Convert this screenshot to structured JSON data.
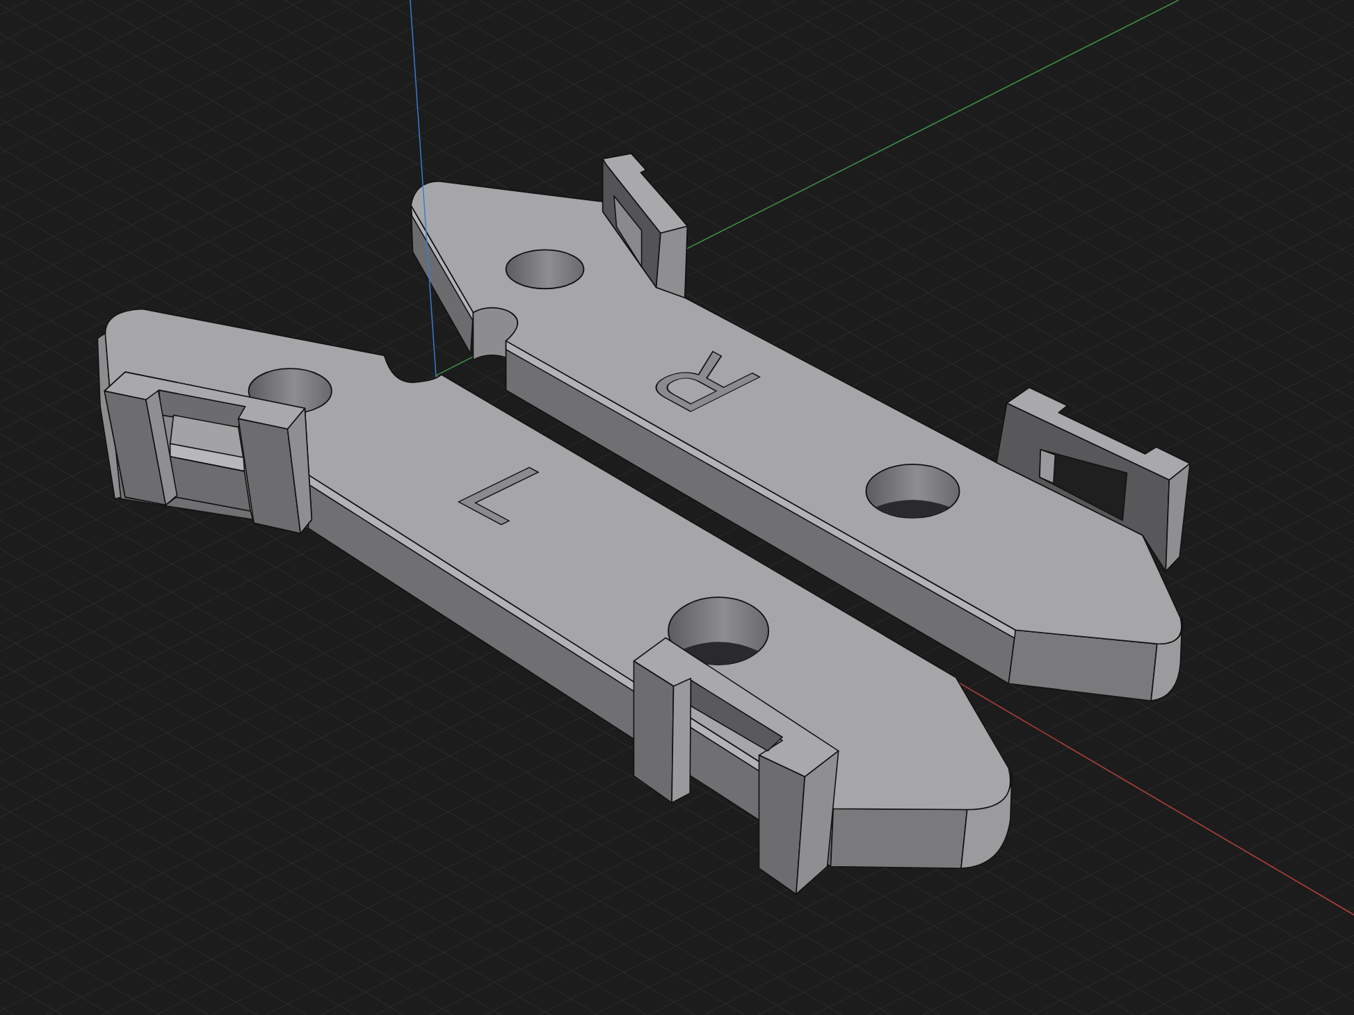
{
  "viewport": {
    "axes": [
      {
        "kind": "x",
        "color": "#b8403a"
      },
      {
        "kind": "y",
        "color": "#3e9146"
      },
      {
        "kind": "z",
        "color": "#3b7bd0"
      }
    ],
    "parts": [
      {
        "engraving": "R"
      },
      {
        "engraving": "L"
      }
    ]
  }
}
